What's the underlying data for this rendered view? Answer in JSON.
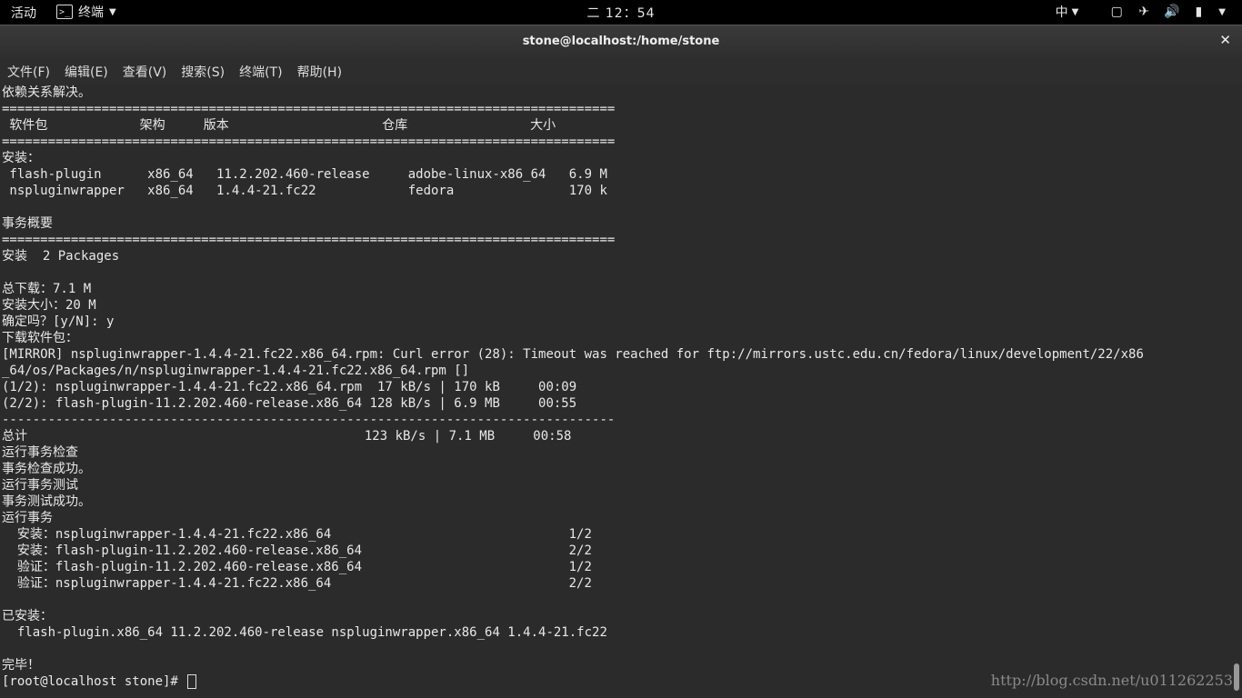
{
  "topbar": {
    "activities": "活动",
    "app_name": "终端",
    "clock": "二 12：54",
    "input_method": "中"
  },
  "window": {
    "title": "stone@localhost:/home/stone"
  },
  "menu": {
    "file": "文件(F)",
    "edit": "编辑(E)",
    "view": "查看(V)",
    "search": "搜索(S)",
    "terminal": "终端(T)",
    "help": "帮助(H)"
  },
  "terminal": {
    "lines": [
      "依赖关系解决。",
      "================================================================================",
      " 软件包            架构     版本                    仓库                大小",
      "================================================================================",
      "安装：",
      " flash-plugin      x86_64   11.2.202.460-release     adobe-linux-x86_64   6.9 M",
      " nspluginwrapper   x86_64   1.4.4-21.fc22            fedora               170 k",
      "",
      "事务概要",
      "================================================================================",
      "安装  2 Packages",
      "",
      "总下载：7.1 M",
      "安装大小：20 M",
      "确定吗？[y/N]: y",
      "下载软件包：",
      "[MIRROR] nspluginwrapper-1.4.4-21.fc22.x86_64.rpm: Curl error (28): Timeout was reached for ftp://mirrors.ustc.edu.cn/fedora/linux/development/22/x86",
      "_64/os/Packages/n/nspluginwrapper-1.4.4-21.fc22.x86_64.rpm []",
      "(1/2): nspluginwrapper-1.4.4-21.fc22.x86_64.rpm  17 kB/s | 170 kB     00:09",
      "(2/2): flash-plugin-11.2.202.460-release.x86_64 128 kB/s | 6.9 MB     00:55",
      "--------------------------------------------------------------------------------",
      "总计                                            123 kB/s | 7.1 MB     00:58",
      "运行事务检查",
      "事务检查成功。",
      "运行事务测试",
      "事务测试成功。",
      "运行事务",
      "  安装：nspluginwrapper-1.4.4-21.fc22.x86_64                               1/2",
      "  安装：flash-plugin-11.2.202.460-release.x86_64                           2/2",
      "  验证：flash-plugin-11.2.202.460-release.x86_64                           1/2",
      "  验证：nspluginwrapper-1.4.4-21.fc22.x86_64                               2/2",
      "",
      "已安装：",
      "  flash-plugin.x86_64 11.2.202.460-release nspluginwrapper.x86_64 1.4.4-21.fc22",
      "",
      "完毕！"
    ],
    "prompt": "[root@localhost stone]# "
  },
  "watermark": "http://blog.csdn.net/u011262253"
}
